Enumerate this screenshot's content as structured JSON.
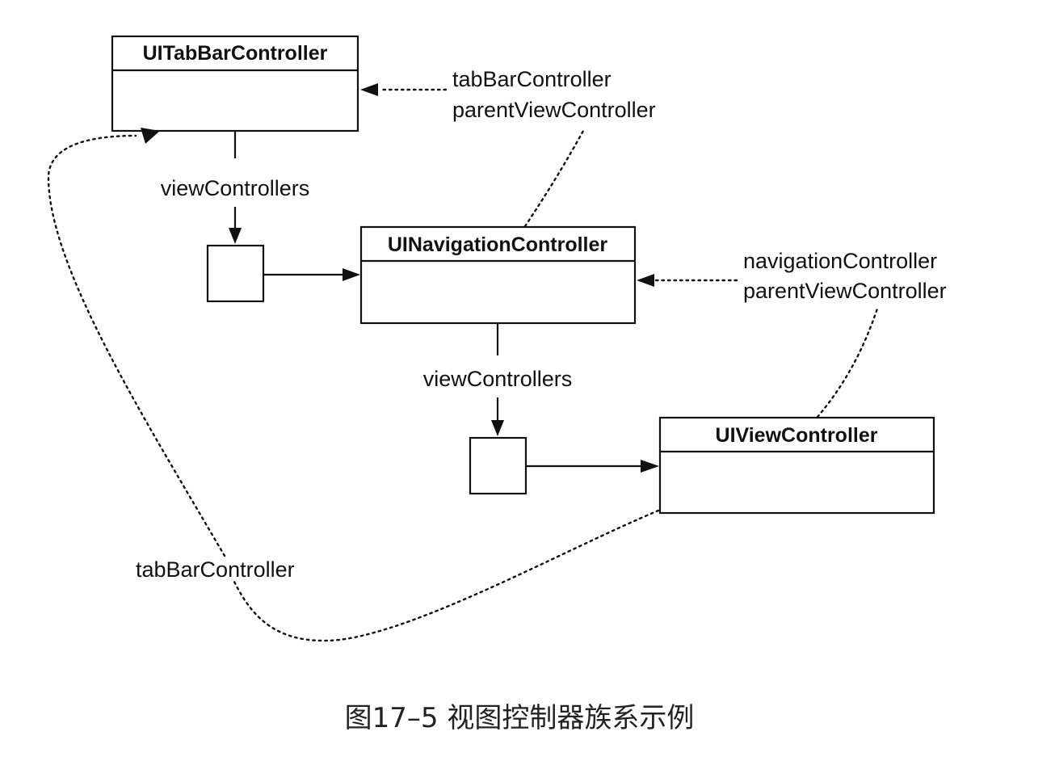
{
  "classes": {
    "tab_bar_controller": "UITabBarController",
    "navigation_controller": "UINavigationController",
    "view_controller": "UIViewController"
  },
  "labels": {
    "view_controllers_top": "viewControllers",
    "view_controllers_mid": "viewControllers",
    "tab_bar_controller_ref": "tabBarController",
    "parent_view_controller_top": "parentViewController",
    "navigation_controller_ref": "navigationController",
    "parent_view_controller_right": "parentViewController",
    "tab_bar_controller_bottom": "tabBarController"
  },
  "caption": "图17–5  视图控制器族系示例"
}
